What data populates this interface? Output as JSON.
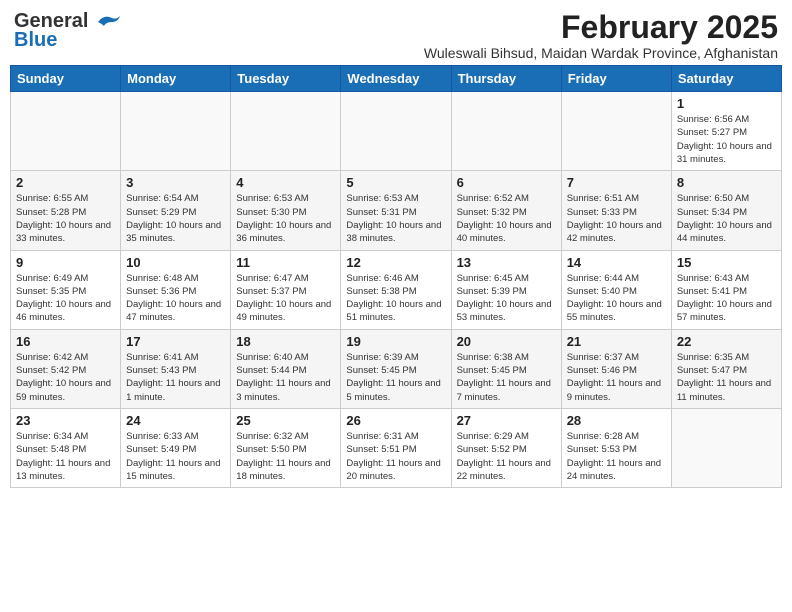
{
  "header": {
    "logo_general": "General",
    "logo_blue": "Blue",
    "month_title": "February 2025",
    "subtitle": "Wuleswali Bihsud, Maidan Wardak Province, Afghanistan"
  },
  "weekdays": [
    "Sunday",
    "Monday",
    "Tuesday",
    "Wednesday",
    "Thursday",
    "Friday",
    "Saturday"
  ],
  "weeks": [
    {
      "cells": [
        {
          "day": "",
          "info": ""
        },
        {
          "day": "",
          "info": ""
        },
        {
          "day": "",
          "info": ""
        },
        {
          "day": "",
          "info": ""
        },
        {
          "day": "",
          "info": ""
        },
        {
          "day": "",
          "info": ""
        },
        {
          "day": "1",
          "info": "Sunrise: 6:56 AM\nSunset: 5:27 PM\nDaylight: 10 hours and 31 minutes."
        }
      ]
    },
    {
      "cells": [
        {
          "day": "2",
          "info": "Sunrise: 6:55 AM\nSunset: 5:28 PM\nDaylight: 10 hours and 33 minutes."
        },
        {
          "day": "3",
          "info": "Sunrise: 6:54 AM\nSunset: 5:29 PM\nDaylight: 10 hours and 35 minutes."
        },
        {
          "day": "4",
          "info": "Sunrise: 6:53 AM\nSunset: 5:30 PM\nDaylight: 10 hours and 36 minutes."
        },
        {
          "day": "5",
          "info": "Sunrise: 6:53 AM\nSunset: 5:31 PM\nDaylight: 10 hours and 38 minutes."
        },
        {
          "day": "6",
          "info": "Sunrise: 6:52 AM\nSunset: 5:32 PM\nDaylight: 10 hours and 40 minutes."
        },
        {
          "day": "7",
          "info": "Sunrise: 6:51 AM\nSunset: 5:33 PM\nDaylight: 10 hours and 42 minutes."
        },
        {
          "day": "8",
          "info": "Sunrise: 6:50 AM\nSunset: 5:34 PM\nDaylight: 10 hours and 44 minutes."
        }
      ]
    },
    {
      "cells": [
        {
          "day": "9",
          "info": "Sunrise: 6:49 AM\nSunset: 5:35 PM\nDaylight: 10 hours and 46 minutes."
        },
        {
          "day": "10",
          "info": "Sunrise: 6:48 AM\nSunset: 5:36 PM\nDaylight: 10 hours and 47 minutes."
        },
        {
          "day": "11",
          "info": "Sunrise: 6:47 AM\nSunset: 5:37 PM\nDaylight: 10 hours and 49 minutes."
        },
        {
          "day": "12",
          "info": "Sunrise: 6:46 AM\nSunset: 5:38 PM\nDaylight: 10 hours and 51 minutes."
        },
        {
          "day": "13",
          "info": "Sunrise: 6:45 AM\nSunset: 5:39 PM\nDaylight: 10 hours and 53 minutes."
        },
        {
          "day": "14",
          "info": "Sunrise: 6:44 AM\nSunset: 5:40 PM\nDaylight: 10 hours and 55 minutes."
        },
        {
          "day": "15",
          "info": "Sunrise: 6:43 AM\nSunset: 5:41 PM\nDaylight: 10 hours and 57 minutes."
        }
      ]
    },
    {
      "cells": [
        {
          "day": "16",
          "info": "Sunrise: 6:42 AM\nSunset: 5:42 PM\nDaylight: 10 hours and 59 minutes."
        },
        {
          "day": "17",
          "info": "Sunrise: 6:41 AM\nSunset: 5:43 PM\nDaylight: 11 hours and 1 minute."
        },
        {
          "day": "18",
          "info": "Sunrise: 6:40 AM\nSunset: 5:44 PM\nDaylight: 11 hours and 3 minutes."
        },
        {
          "day": "19",
          "info": "Sunrise: 6:39 AM\nSunset: 5:45 PM\nDaylight: 11 hours and 5 minutes."
        },
        {
          "day": "20",
          "info": "Sunrise: 6:38 AM\nSunset: 5:45 PM\nDaylight: 11 hours and 7 minutes."
        },
        {
          "day": "21",
          "info": "Sunrise: 6:37 AM\nSunset: 5:46 PM\nDaylight: 11 hours and 9 minutes."
        },
        {
          "day": "22",
          "info": "Sunrise: 6:35 AM\nSunset: 5:47 PM\nDaylight: 11 hours and 11 minutes."
        }
      ]
    },
    {
      "cells": [
        {
          "day": "23",
          "info": "Sunrise: 6:34 AM\nSunset: 5:48 PM\nDaylight: 11 hours and 13 minutes."
        },
        {
          "day": "24",
          "info": "Sunrise: 6:33 AM\nSunset: 5:49 PM\nDaylight: 11 hours and 15 minutes."
        },
        {
          "day": "25",
          "info": "Sunrise: 6:32 AM\nSunset: 5:50 PM\nDaylight: 11 hours and 18 minutes."
        },
        {
          "day": "26",
          "info": "Sunrise: 6:31 AM\nSunset: 5:51 PM\nDaylight: 11 hours and 20 minutes."
        },
        {
          "day": "27",
          "info": "Sunrise: 6:29 AM\nSunset: 5:52 PM\nDaylight: 11 hours and 22 minutes."
        },
        {
          "day": "28",
          "info": "Sunrise: 6:28 AM\nSunset: 5:53 PM\nDaylight: 11 hours and 24 minutes."
        },
        {
          "day": "",
          "info": ""
        }
      ]
    }
  ]
}
